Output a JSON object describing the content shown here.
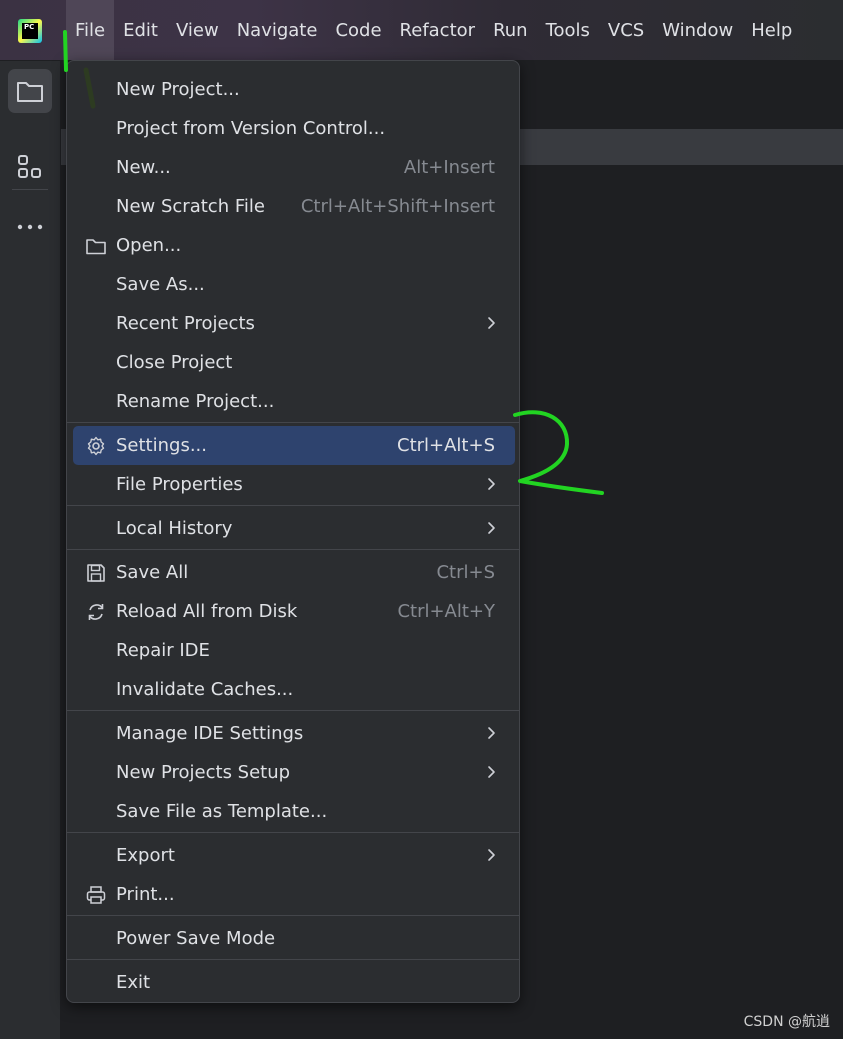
{
  "app": {
    "logo_text": "PC",
    "icon": "pycharm-logo-icon"
  },
  "menubar": [
    {
      "label": "File",
      "active": true
    },
    {
      "label": "Edit"
    },
    {
      "label": "View"
    },
    {
      "label": "Navigate"
    },
    {
      "label": "Code"
    },
    {
      "label": "Refactor"
    },
    {
      "label": "Run"
    },
    {
      "label": "Tools"
    },
    {
      "label": "VCS"
    },
    {
      "label": "Window"
    },
    {
      "label": "Help"
    }
  ],
  "toolstrip": {
    "icons": [
      "folder-icon",
      "structure-icon",
      "more-icon"
    ]
  },
  "file_menu": {
    "groups": [
      [
        {
          "label": "New Project..."
        },
        {
          "label": "Project from Version Control..."
        },
        {
          "label": "New...",
          "shortcut": "Alt+Insert"
        },
        {
          "label": "New Scratch File",
          "shortcut": "Ctrl+Alt+Shift+Insert"
        },
        {
          "label": "Open...",
          "icon": "folder-icon"
        },
        {
          "label": "Save As..."
        },
        {
          "label": "Recent Projects",
          "submenu": true
        },
        {
          "label": "Close Project"
        },
        {
          "label": "Rename Project..."
        }
      ],
      [
        {
          "label": "Settings...",
          "shortcut": "Ctrl+Alt+S",
          "icon": "gear-icon",
          "selected": true
        },
        {
          "label": "File Properties",
          "submenu": true
        }
      ],
      [
        {
          "label": "Local History",
          "submenu": true
        }
      ],
      [
        {
          "label": "Save All",
          "shortcut": "Ctrl+S",
          "icon": "save-icon"
        },
        {
          "label": "Reload All from Disk",
          "shortcut": "Ctrl+Alt+Y",
          "icon": "reload-icon"
        },
        {
          "label": "Repair IDE"
        },
        {
          "label": "Invalidate Caches..."
        }
      ],
      [
        {
          "label": "Manage IDE Settings",
          "submenu": true
        },
        {
          "label": "New Projects Setup",
          "submenu": true
        },
        {
          "label": "Save File as Template..."
        }
      ],
      [
        {
          "label": "Export",
          "submenu": true
        },
        {
          "label": "Print...",
          "icon": "printer-icon"
        }
      ],
      [
        {
          "label": "Power Save Mode"
        }
      ],
      [
        {
          "label": "Exit"
        }
      ]
    ]
  },
  "colors": {
    "menu_bg": "#2b2d30",
    "selection": "#2e436e",
    "annotation": "#22d422",
    "shortcut_text": "#868a91"
  },
  "watermark": "CSDN @航逍"
}
